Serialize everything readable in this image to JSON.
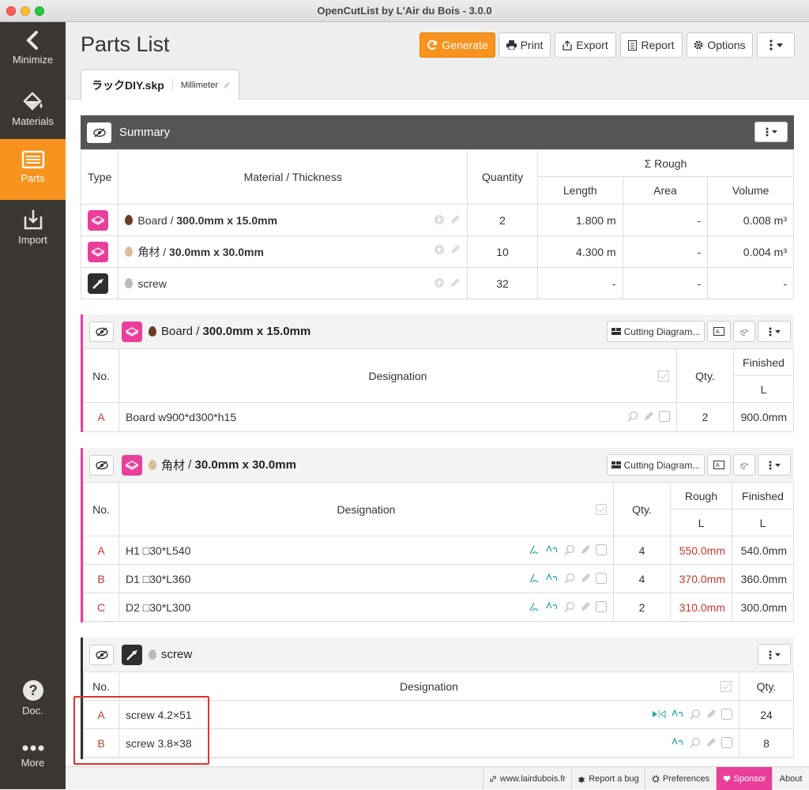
{
  "window": {
    "title": "OpenCutList by L'Air du Bois - 3.0.0"
  },
  "sidebar": {
    "items": [
      {
        "label": "Minimize",
        "icon": "chevron-left-icon"
      },
      {
        "label": "Materials",
        "icon": "paint-bucket-icon"
      },
      {
        "label": "Parts",
        "icon": "list-icon",
        "active": true
      },
      {
        "label": "Import",
        "icon": "import-icon"
      },
      {
        "label": "Doc.",
        "icon": "question-icon"
      },
      {
        "label": "More",
        "icon": "dots-icon"
      }
    ]
  },
  "header": {
    "title": "Parts List",
    "buttons": {
      "generate": "Generate",
      "print": "Print",
      "export": "Export",
      "report": "Report",
      "options": "Options"
    },
    "file_tab": {
      "name": "ラックDIY.skp",
      "unit": "Millimeter"
    }
  },
  "summary": {
    "title": "Summary",
    "columns": {
      "type": "Type",
      "material": "Material / Thickness",
      "quantity": "Quantity",
      "rough": "Σ Rough",
      "length": "Length",
      "area": "Area",
      "volume": "Volume"
    },
    "rows": [
      {
        "material": "Board",
        "thickness": "300.0mm x 15.0mm",
        "quantity": "2",
        "length": "1.800 m",
        "area": "-",
        "volume": "0.008 m³",
        "type_icon": "sheet-icon",
        "drop_color": "#6b3d25"
      },
      {
        "material": "角材",
        "thickness": "30.0mm x 30.0mm",
        "quantity": "10",
        "length": "4.300 m",
        "area": "-",
        "volume": "0.004 m³",
        "type_icon": "sheet-icon",
        "drop_color": "#d8bf9c"
      },
      {
        "material": "screw",
        "thickness": "",
        "quantity": "32",
        "length": "-",
        "area": "-",
        "volume": "-",
        "type_icon": "hardware-icon",
        "drop_color": "#bbbbbb"
      }
    ]
  },
  "groups": [
    {
      "material": "Board",
      "thickness": "300.0mm x 15.0mm",
      "cutting_diagram": "Cutting Diagram...",
      "columns": {
        "no": "No.",
        "designation": "Designation",
        "qty": "Qty.",
        "finished": "Finished",
        "l": "L"
      },
      "parts": [
        {
          "no": "A",
          "designation": "Board w900*d300*h15",
          "qty": "2",
          "finished_l": "900.0mm"
        }
      ]
    },
    {
      "material": "角材",
      "thickness": "30.0mm x 30.0mm",
      "cutting_diagram": "Cutting Diagram...",
      "columns": {
        "no": "No.",
        "designation": "Designation",
        "qty": "Qty.",
        "rough": "Rough",
        "finished": "Finished",
        "l": "L"
      },
      "parts": [
        {
          "no": "A",
          "designation": "H1 □30*L540",
          "qty": "4",
          "rough_l": "550.0mm",
          "finished_l": "540.0mm"
        },
        {
          "no": "B",
          "designation": "D1 □30*L360",
          "qty": "4",
          "rough_l": "370.0mm",
          "finished_l": "360.0mm"
        },
        {
          "no": "C",
          "designation": "D2 □30*L300",
          "qty": "2",
          "rough_l": "310.0mm",
          "finished_l": "300.0mm"
        }
      ]
    },
    {
      "material": "screw",
      "columns": {
        "no": "No.",
        "designation": "Designation",
        "qty": "Qty."
      },
      "parts": [
        {
          "no": "A",
          "designation": "screw 4.2×51",
          "qty": "24"
        },
        {
          "no": "B",
          "designation": "screw 3.8×38",
          "qty": "8"
        }
      ]
    }
  ],
  "footer": {
    "website": "www.lairdubois.fr",
    "bug": "Report a bug",
    "preferences": "Preferences",
    "sponsor": "Sponsor",
    "about": "About"
  },
  "colors": {
    "accent": "#f7931e",
    "pink": "#e93f9b",
    "sidebar": "#3b3833",
    "rough_text": "#c0392b"
  }
}
